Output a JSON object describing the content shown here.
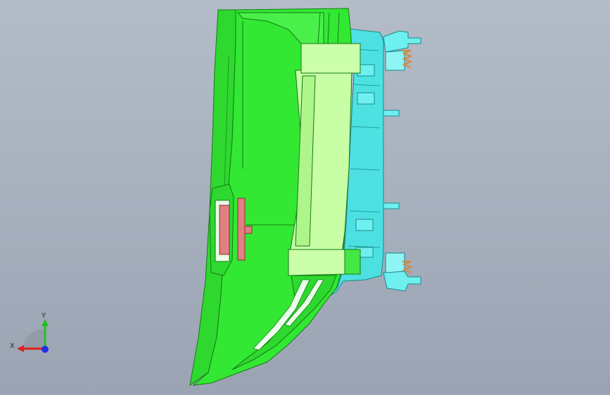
{
  "viewport": {
    "background_top": "#b4bcc8",
    "background_bottom": "#9aa3b2"
  },
  "model": {
    "main_body_color": "#33e833",
    "highlight_color": "#ccffaa",
    "transparent_part_color": "#44e6e6",
    "clip_color": "#e08080",
    "spring_color": "#d08a3a"
  },
  "triad": {
    "x_label": "X",
    "y_label": "Y",
    "x_color": "#e02020",
    "y_color": "#20c020",
    "z_color": "#2030e0"
  }
}
